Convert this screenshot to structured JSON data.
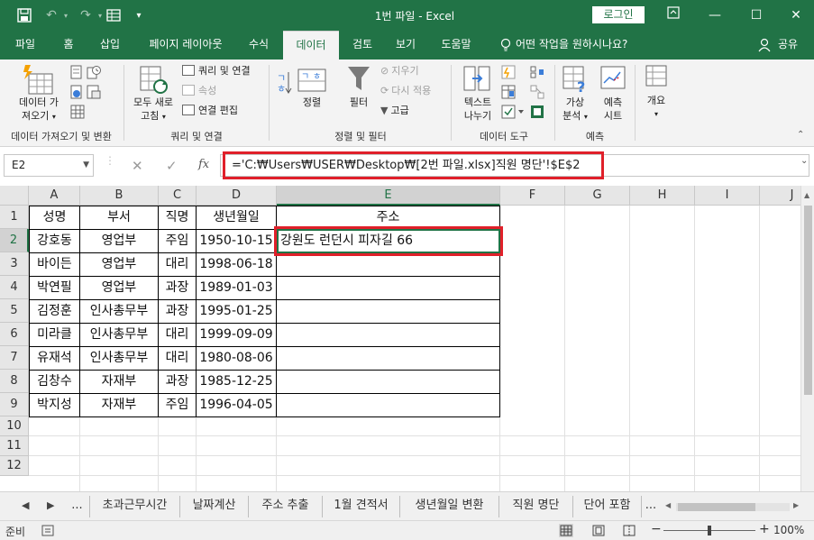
{
  "app": {
    "title": "1번 파일  -  Excel",
    "login_label": "로그인",
    "accent": "#217346",
    "highlight": "#e0202a"
  },
  "quick_access": [
    "save-icon",
    "undo-icon",
    "redo-icon",
    "form-icon",
    "customize-icon"
  ],
  "tabs": [
    {
      "label": "파일"
    },
    {
      "label": "홈"
    },
    {
      "label": "삽입"
    },
    {
      "label": "페이지 레이아웃"
    },
    {
      "label": "수식"
    },
    {
      "label": "데이터",
      "active": true
    },
    {
      "label": "검토"
    },
    {
      "label": "보기"
    },
    {
      "label": "도움말"
    },
    {
      "label": "어떤 작업을 원하시나요?"
    },
    {
      "label": "공유"
    }
  ],
  "ribbon": {
    "get_data": {
      "label1": "데이터 가",
      "label2": "져오기",
      "group": "데이터 가져오기 및 변환"
    },
    "refresh_all": {
      "label1": "모두 새로",
      "label2": "고침"
    },
    "queries": {
      "queries_conn": "쿼리 및 연결",
      "properties": "속성",
      "edit_links": "연결 편집",
      "group": "쿼리 및 연결"
    },
    "sort": {
      "az": "ㄱ\nㅎ",
      "label": "정렬"
    },
    "filter": {
      "label": "필터",
      "clear": "지우기",
      "reapply": "다시 적용",
      "advanced": "고급",
      "group": "정렬 및 필터"
    },
    "text_to_columns": {
      "label1": "텍스트",
      "label2": "나누기",
      "group": "데이터 도구"
    },
    "what_if": {
      "label1": "가상",
      "label2": "분석"
    },
    "forecast": {
      "label1": "예측",
      "label2": "시트",
      "group": "예측"
    },
    "outline": {
      "label": "개요"
    }
  },
  "formula_bar": {
    "name_box": "E2",
    "cancel": "✕",
    "enter": "✓",
    "fx": "fx",
    "formula": "='C:₩Users₩USER₩Desktop₩[2번 파일.xlsx]직원 명단'!$E$2"
  },
  "columns": [
    "A",
    "B",
    "C",
    "D",
    "E",
    "F",
    "G",
    "H",
    "I",
    "J"
  ],
  "rows": [
    "1",
    "2",
    "3",
    "4",
    "5",
    "6",
    "7",
    "8",
    "9",
    "10",
    "11",
    "12"
  ],
  "table": {
    "headers": [
      "성명",
      "부서",
      "직명",
      "생년월일",
      "주소"
    ],
    "rows": [
      [
        "강호동",
        "영업부",
        "주임",
        "1950-10-15",
        "강원도 런던시 피자길 66"
      ],
      [
        "바이든",
        "영업부",
        "대리",
        "1998-06-18",
        ""
      ],
      [
        "박연필",
        "영업부",
        "과장",
        "1989-01-03",
        ""
      ],
      [
        "김정훈",
        "인사총무부",
        "과장",
        "1995-01-25",
        ""
      ],
      [
        "미라클",
        "인사총무부",
        "대리",
        "1999-09-09",
        ""
      ],
      [
        "유재석",
        "인사총무부",
        "대리",
        "1980-08-06",
        ""
      ],
      [
        "김창수",
        "자재부",
        "과장",
        "1985-12-25",
        ""
      ],
      [
        "박지성",
        "자재부",
        "주임",
        "1996-04-05",
        ""
      ]
    ]
  },
  "sheet_tabs": [
    "...",
    "초과근무시간",
    "날짜계산",
    "주소 추출",
    "1월 견적서",
    "생년월일 변환",
    "직원 명단",
    "단어 포함",
    "..."
  ],
  "status": {
    "ready": "준비",
    "zoom": "100%"
  }
}
